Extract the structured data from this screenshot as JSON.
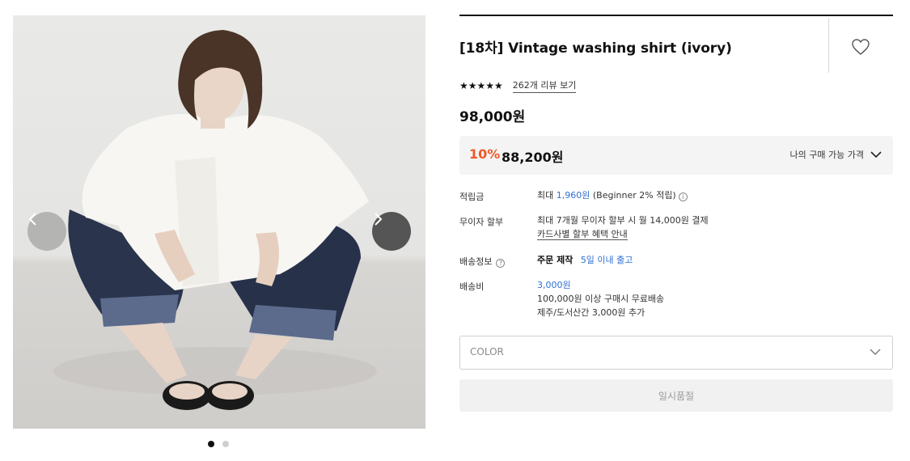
{
  "gallery": {
    "prev_icon": "chevron-left-icon",
    "next_icon": "chevron-right-icon",
    "slide_count": 2,
    "active_slide": 1
  },
  "product": {
    "title": "[18차] Vintage washing shirt (ivory)",
    "wishlist_icon": "heart-outline-icon",
    "rating_stars": "★★★★★",
    "rating_value": 5,
    "review_link": "262개 리뷰 보기",
    "price": "98,000원"
  },
  "discount": {
    "rate": "10%",
    "price": "88,200원",
    "toggle_label": "나의 구매 가능 가격",
    "rate_color": "#ef5a27"
  },
  "details": {
    "points": {
      "label": "적립금",
      "prefix": "최대 ",
      "amount": "1,960원",
      "suffix": " (Beginner 2% 적립)",
      "info_icon": "i"
    },
    "installment": {
      "label": "무이자 할부",
      "line1": "최대 7개월 무이자 할부 시 월 14,000원 결제",
      "link": "카드사별 할부 혜택 안내"
    },
    "shipping_info": {
      "label": "배송정보",
      "help_icon": "?",
      "order_type": "주문 제작",
      "lead_time": "5일 이내 출고"
    },
    "shipping_fee": {
      "label": "배송비",
      "amount": "3,000원",
      "line1": "100,000원 이상 구매시 무료배송",
      "line2": "제주/도서산간 3,000원 추가"
    }
  },
  "options": {
    "color_select_placeholder": "COLOR"
  },
  "actions": {
    "soldout_label": "일시품절"
  },
  "colors": {
    "accent_blue": "#2f6fd2",
    "discount_orange": "#ef5a27"
  }
}
